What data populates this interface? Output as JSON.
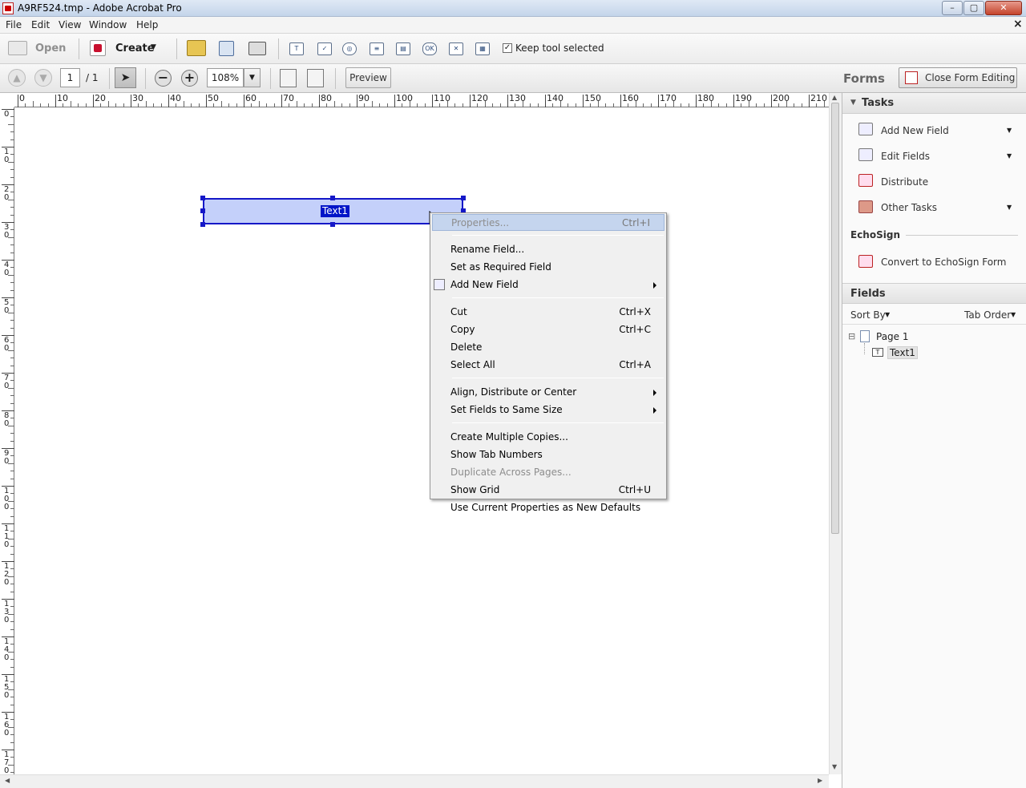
{
  "window": {
    "title": "A9RF524.tmp - Adobe Acrobat Pro"
  },
  "menubar": {
    "items": [
      "File",
      "Edit",
      "View",
      "Window",
      "Help"
    ],
    "close_glyph": "×"
  },
  "toolbar1": {
    "open_label": "Open",
    "create_label": "Create",
    "form_tool_labels": [
      "T",
      "✓",
      "◎",
      "≡",
      "▤",
      "OK",
      "✕",
      "▦"
    ],
    "keep_tool_label": "Keep tool selected",
    "keep_tool_checked": true
  },
  "toolbar2": {
    "page_current": "1",
    "page_total": "/ 1",
    "zoom": "108%",
    "preview_label": "Preview",
    "forms_label": "Forms",
    "close_form_label": "Close Form Editing"
  },
  "ruler": {
    "top_ticks": [
      "0",
      "10",
      "20",
      "30",
      "40",
      "50",
      "60",
      "70",
      "80",
      "90",
      "100",
      "110",
      "120",
      "130",
      "140",
      "150",
      "160",
      "170",
      "180",
      "190",
      "200",
      "210"
    ],
    "left_ticks": [
      [
        "0"
      ],
      [
        "1",
        "0"
      ],
      [
        "2",
        "0"
      ],
      [
        "3",
        "0"
      ],
      [
        "4",
        "0"
      ],
      [
        "5",
        "0"
      ],
      [
        "6",
        "0"
      ],
      [
        "7",
        "0"
      ],
      [
        "8",
        "0"
      ],
      [
        "9",
        "0"
      ],
      [
        "1",
        "0",
        "0"
      ],
      [
        "1",
        "1",
        "0"
      ],
      [
        "1",
        "2",
        "0"
      ],
      [
        "1",
        "3",
        "0"
      ],
      [
        "1",
        "4",
        "0"
      ],
      [
        "1",
        "5",
        "0"
      ],
      [
        "1",
        "6",
        "0"
      ],
      [
        "1",
        "7",
        "0"
      ]
    ]
  },
  "field": {
    "label": "Text1"
  },
  "context_menu": {
    "items": [
      {
        "label": "Properties...",
        "shortcut": "Ctrl+I",
        "highlighted": true
      },
      {
        "sep": true
      },
      {
        "label": "Rename Field..."
      },
      {
        "label": "Set as Required Field"
      },
      {
        "label": "Add New Field",
        "submenu": true,
        "icon": true
      },
      {
        "sep": true
      },
      {
        "label": "Cut",
        "shortcut": "Ctrl+X"
      },
      {
        "label": "Copy",
        "shortcut": "Ctrl+C"
      },
      {
        "label": "Delete"
      },
      {
        "label": "Select All",
        "shortcut": "Ctrl+A"
      },
      {
        "sep": true
      },
      {
        "label": "Align, Distribute or Center",
        "submenu": true
      },
      {
        "label": "Set Fields to Same Size",
        "submenu": true
      },
      {
        "sep": true
      },
      {
        "label": "Create Multiple Copies..."
      },
      {
        "label": "Show Tab Numbers"
      },
      {
        "label": "Duplicate Across Pages...",
        "disabled": true
      },
      {
        "label": "Show Grid",
        "shortcut": "Ctrl+U"
      },
      {
        "label": "Use Current Properties as New Defaults"
      }
    ]
  },
  "right_panel": {
    "tasks_header": "Tasks",
    "tasks": [
      {
        "label": "Add New Field",
        "dropdown": true,
        "icon": "add-field-icon"
      },
      {
        "label": "Edit Fields",
        "dropdown": true,
        "icon": "edit-fields-icon"
      },
      {
        "label": "Distribute",
        "dropdown": false,
        "icon": "distribute-icon"
      },
      {
        "label": "Other Tasks",
        "dropdown": true,
        "icon": "toolbox-icon"
      }
    ],
    "echosign_header": "EchoSign",
    "echosign_task": "Convert to EchoSign Form",
    "fields_header": "Fields",
    "sort_by": "Sort By",
    "tab_order": "Tab Order",
    "tree": {
      "page": "Page 1",
      "field": "Text1",
      "expand_glyph": "⊟"
    }
  },
  "colors": {
    "accent": "#1518c8",
    "field_fill": "#c4d0fa",
    "menu_highlight": "#c5d5ee"
  }
}
